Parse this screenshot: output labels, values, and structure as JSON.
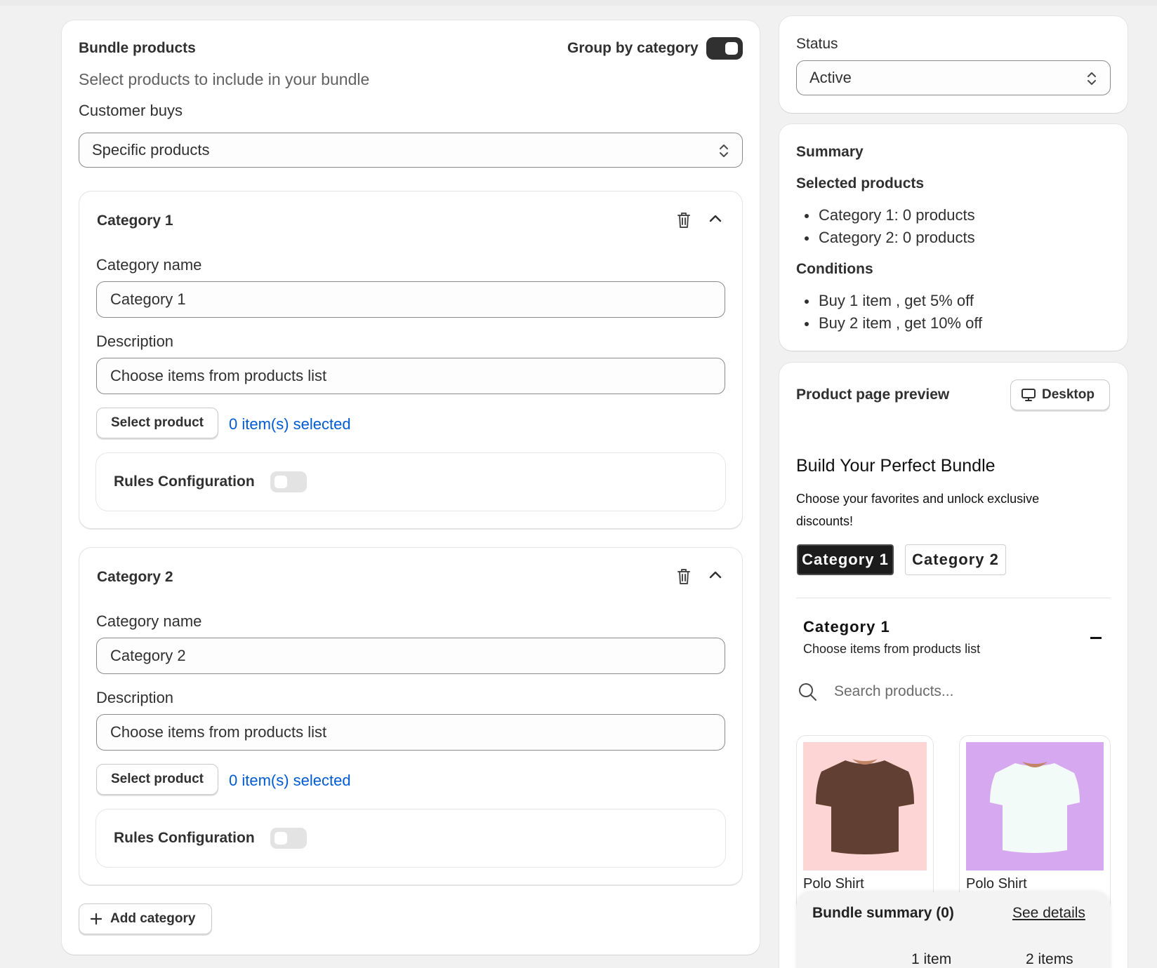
{
  "bundle": {
    "title": "Bundle products",
    "group_label": "Group by category",
    "subtitle": "Select products to include in your bundle",
    "customer_buys_label": "Customer buys",
    "customer_buys_value": "Specific products",
    "add_category_label": "Add category"
  },
  "categories": [
    {
      "header": "Category 1",
      "name_label": "Category name",
      "name_value": "Category 1",
      "desc_label": "Description",
      "desc_value": "Choose items from products list",
      "select_label": "Select product",
      "selected_text": "0 item(s) selected",
      "rules_label": "Rules Configuration"
    },
    {
      "header": "Category 2",
      "name_label": "Category name",
      "name_value": "Category 2",
      "desc_label": "Description",
      "desc_value": "Choose items from products list",
      "select_label": "Select product",
      "selected_text": "0 item(s) selected",
      "rules_label": "Rules Configuration"
    }
  ],
  "status": {
    "label": "Status",
    "value": "Active"
  },
  "summary": {
    "title": "Summary",
    "selected_heading": "Selected products",
    "selected_items": [
      "Category 1: 0 products",
      "Category 2: 0 products"
    ],
    "conditions_heading": "Conditions",
    "conditions": [
      "Buy 1 item , get 5% off",
      "Buy 2 item , get 10% off"
    ]
  },
  "preview": {
    "title": "Product page preview",
    "device_label": "Desktop",
    "headline": "Build Your Perfect Bundle",
    "description": "Choose your favorites and unlock exclusive discounts!",
    "tabs": [
      "Category 1",
      "Category 2"
    ],
    "section_title": "Category 1",
    "section_desc": "Choose items from products list",
    "search_placeholder": "Search products...",
    "products": [
      {
        "name": "Polo Shirt",
        "bg": "#fdd5d5",
        "shirt": "#623f33"
      },
      {
        "name": "Polo Shirt",
        "bg": "#d6a8f0",
        "shirt": "#f3fbf8"
      }
    ],
    "bundle_summary_label": "Bundle summary (0)",
    "see_details": "See details",
    "tiers": [
      "1 item",
      "2 items"
    ]
  }
}
